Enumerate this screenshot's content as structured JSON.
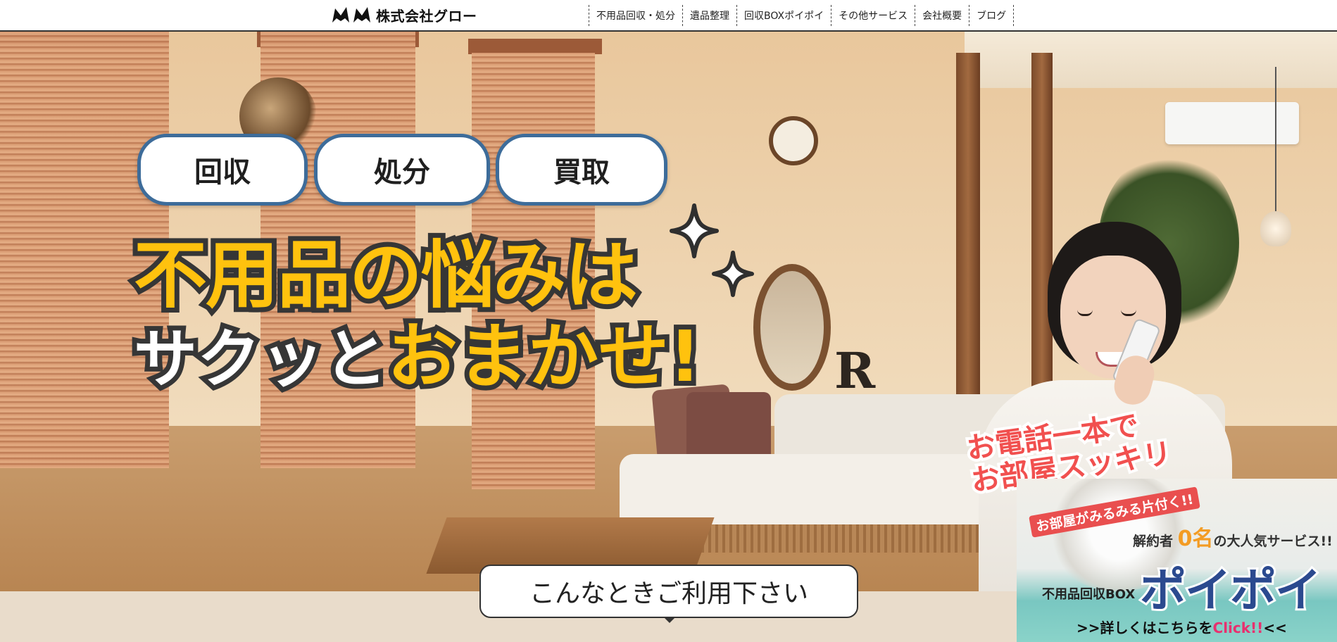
{
  "header": {
    "company_name": "株式会社グロー",
    "nav": [
      "不用品回収・処分",
      "遺品整理",
      "回収BOXポイポイ",
      "その他サービス",
      "会社概要",
      "ブログ"
    ]
  },
  "hero": {
    "services": [
      "回収",
      "処分",
      "買取"
    ],
    "headline_line1": "不用品の悩みは",
    "headline_line2_white": "サクッと",
    "headline_line2_yellow": "おまかせ!",
    "phone_text_line1": "お電話一本で",
    "phone_text_line2": "お部屋スッキリ",
    "sparkle_icon": "sparkle-icon"
  },
  "cta": {
    "label": "こんなときご利用下さい"
  },
  "banner": {
    "tag": "お部屋がみるみる片付く!!",
    "sub_prefix": "解約者",
    "sub_number": "0名",
    "sub_suffix": "の大人気サービス!!",
    "label": "不用品回収BOX",
    "title": "ポイポイ",
    "link_prefix": ">>詳しくはこちらを",
    "link_click": "Click!!",
    "link_suffix": "<<"
  },
  "colors": {
    "accent_yellow": "#ffc20e",
    "pill_border": "#3d6c9a",
    "phone_text": "#f1504f",
    "banner_title": "#2b4a8f",
    "click_pink": "#e8306e"
  }
}
